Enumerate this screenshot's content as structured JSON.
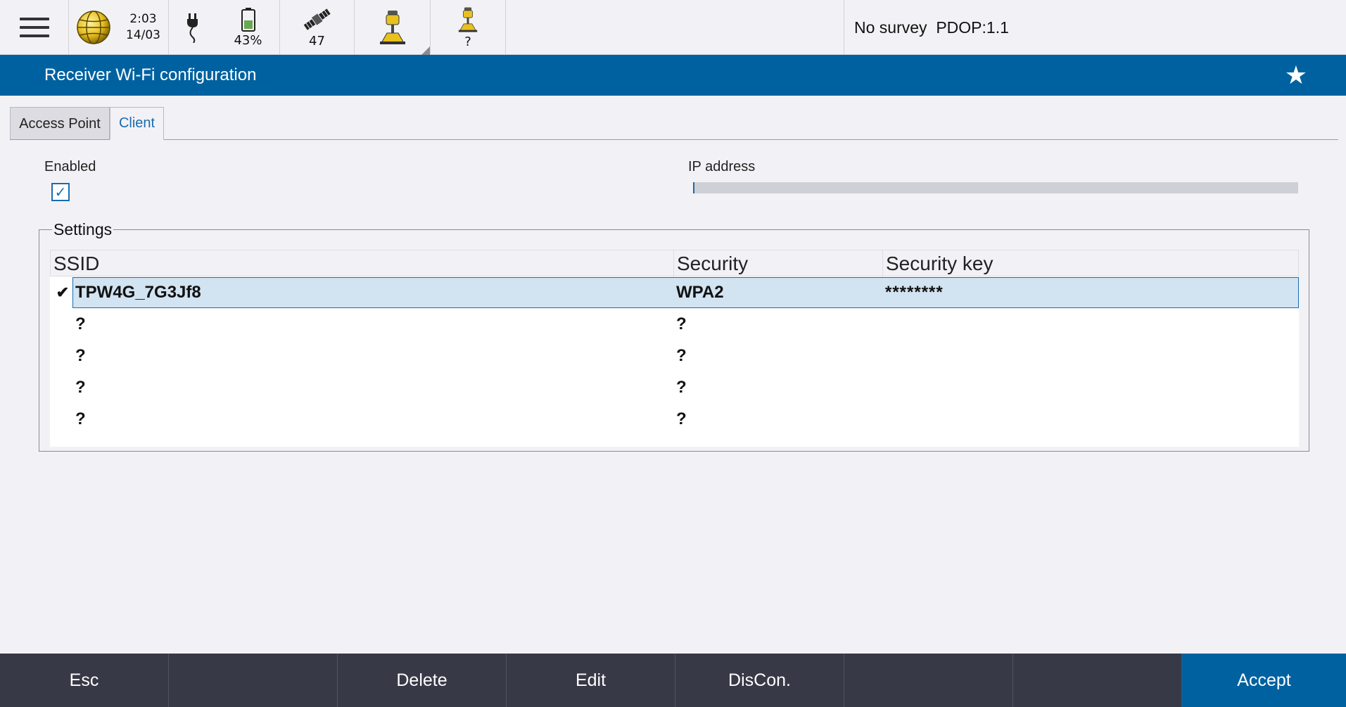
{
  "status_bar": {
    "time": "2:03",
    "date": "14/03",
    "battery_percent": "43%",
    "satellites": "47",
    "rover2_status": "?",
    "survey_status": "No survey",
    "pdop": "PDOP:1.1",
    "icons": [
      "menu-icon",
      "globe-icon",
      "power-plug-icon",
      "battery-icon",
      "satellite-icon",
      "gnss-receiver-icon",
      "gnss-receiver-icon"
    ]
  },
  "title_bar": {
    "title": "Receiver Wi-Fi configuration",
    "favorite_icon": "star-icon"
  },
  "tabs": [
    {
      "label": "Access Point",
      "active": false
    },
    {
      "label": "Client",
      "active": true
    }
  ],
  "form": {
    "enabled_label": "Enabled",
    "enabled_checked": true,
    "ip_label": "IP address",
    "ip_value": ""
  },
  "settings": {
    "group_title": "Settings",
    "columns": [
      "SSID",
      "Security",
      "Security key"
    ],
    "rows": [
      {
        "connected": true,
        "ssid": "TPW4G_7G3Jf8",
        "security": "WPA2",
        "key": "********"
      },
      {
        "connected": false,
        "ssid": "?",
        "security": "?",
        "key": ""
      },
      {
        "connected": false,
        "ssid": "?",
        "security": "?",
        "key": ""
      },
      {
        "connected": false,
        "ssid": "?",
        "security": "?",
        "key": ""
      },
      {
        "connected": false,
        "ssid": "?",
        "security": "?",
        "key": ""
      }
    ]
  },
  "softkeys": [
    "Esc",
    "",
    "Delete",
    "Edit",
    "DisCon.",
    "",
    "",
    "Accept"
  ],
  "colors": {
    "accent": "#0061a0",
    "background": "#f2f2f6",
    "bottom_bar": "#373946",
    "selected_row": "#d2e3f1"
  }
}
